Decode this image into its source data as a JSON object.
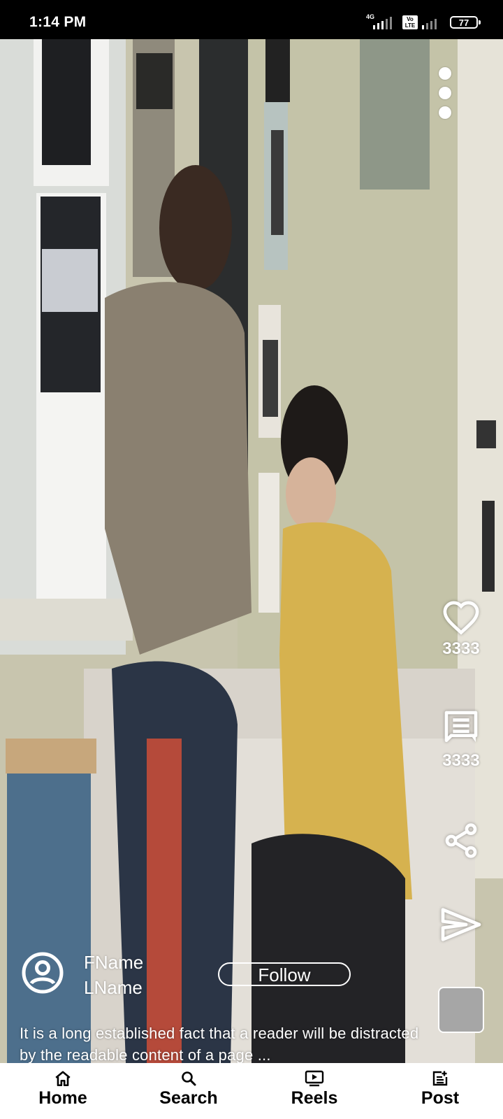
{
  "status_bar": {
    "time": "1:14 PM",
    "network": "4G",
    "volte": "Vo LTE",
    "battery": "77"
  },
  "reel": {
    "likes": "3333",
    "comments": "3333",
    "author": {
      "first_name": "FName",
      "last_name": "LName"
    },
    "follow_label": "Follow",
    "caption": "It is a long established fact that a reader will be distracted by the readable content of a page ..."
  },
  "icons": {
    "menu": "more-vertical-icon",
    "like": "heart-icon",
    "comment": "comment-icon",
    "share": "share-icon",
    "send": "send-icon",
    "avatar": "user-circle-icon"
  },
  "bottom_nav": {
    "items": [
      {
        "label": "Home",
        "icon": "home-icon"
      },
      {
        "label": "Search",
        "icon": "search-icon"
      },
      {
        "label": "Reels",
        "icon": "reels-icon"
      },
      {
        "label": "Post",
        "icon": "post-icon"
      }
    ]
  },
  "colors": {
    "status_bar_bg": "#000000",
    "nav_bg": "#ffffff",
    "overlay_text": "#ffffff",
    "thumbnail": "#a6a6a6"
  }
}
